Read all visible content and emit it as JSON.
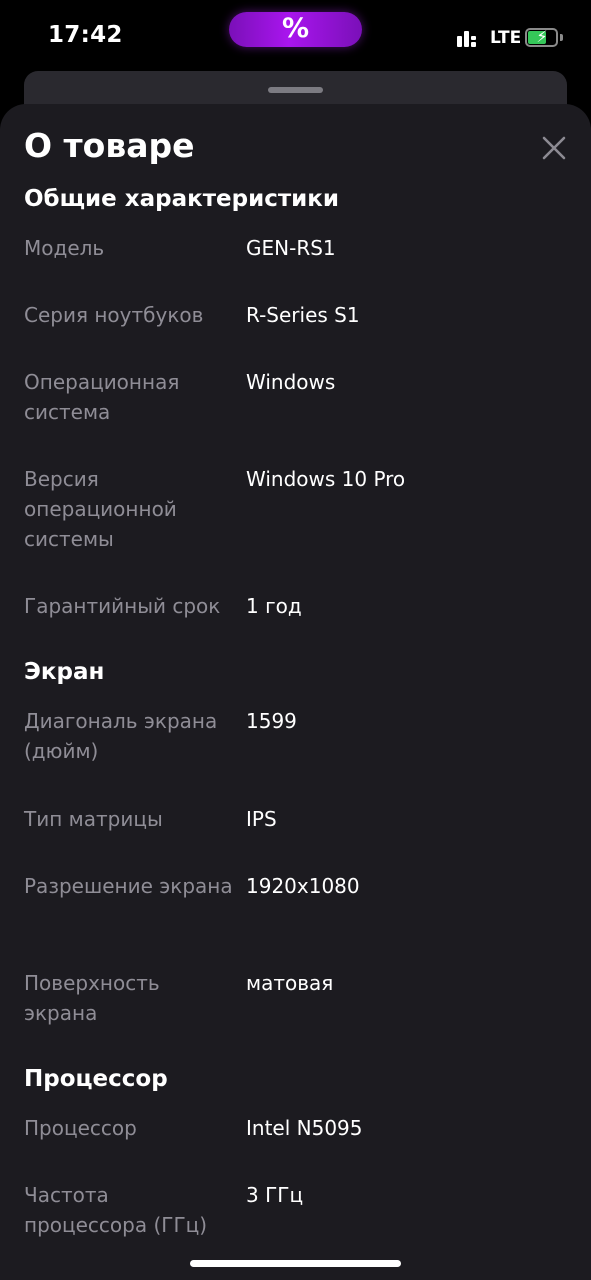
{
  "status_bar": {
    "time": "17:42",
    "island_glyph": "%",
    "network": "LTE",
    "signal_icon": "cellular-signal-icon",
    "battery_icon": "battery-charging-icon",
    "battery_level": 0.63,
    "battery_color": "#35c759"
  },
  "sheet": {
    "title": "О товаре",
    "close_icon": "close-icon",
    "background": "#1c1b20",
    "label_color": "#8f8d96",
    "text_color": "#ffffff"
  },
  "sections": [
    {
      "title": "Общие характеристики",
      "rows": [
        {
          "label": "Модель",
          "value": "GEN-RS1"
        },
        {
          "label": "Серия ноутбуков",
          "value": "R-Series S1"
        },
        {
          "label": "Операционная система",
          "value": "Windows"
        },
        {
          "label": "Версия операционной системы",
          "value": "Windows 10 Pro"
        },
        {
          "label": "Гарантийный срок",
          "value": "1 год"
        }
      ]
    },
    {
      "title": "Экран",
      "rows": [
        {
          "label": "Диагональ экрана (дюйм)",
          "value": "1599"
        },
        {
          "label": "Тип матрицы",
          "value": "IPS"
        },
        {
          "label": "Разрешение экрана",
          "value": "1920x1080"
        },
        {
          "label": "Поверхность экрана",
          "value": "матовая"
        }
      ]
    },
    {
      "title": "Процессор",
      "rows": [
        {
          "label": "Процессор",
          "value": "Intel N5095"
        },
        {
          "label": "Частота процессора (ГГц)",
          "value": "3 ГГц"
        }
      ]
    }
  ]
}
